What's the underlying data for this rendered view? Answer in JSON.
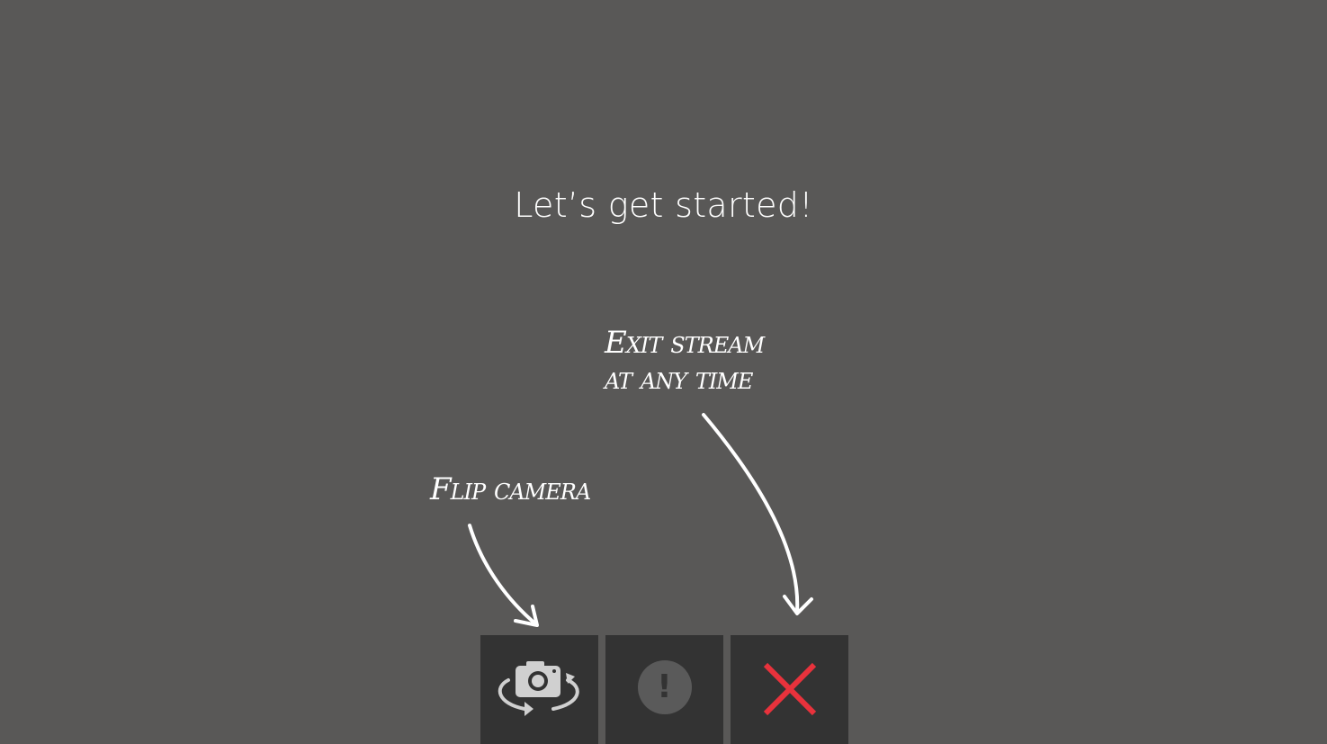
{
  "title": "Let’s get started!",
  "annotations": {
    "exit_line1": "Exit stream",
    "exit_line2": "at any time",
    "flip": "Flip camera"
  },
  "toolbar": {
    "flip_icon": "flip-camera-icon",
    "report_icon": "exclamation-icon",
    "report_glyph": "!",
    "exit_icon": "close-x-icon"
  },
  "colors": {
    "background": "#595857",
    "button_background": "#333333",
    "close_red": "#e8323c",
    "icon_gray": "#d0d0d0"
  }
}
